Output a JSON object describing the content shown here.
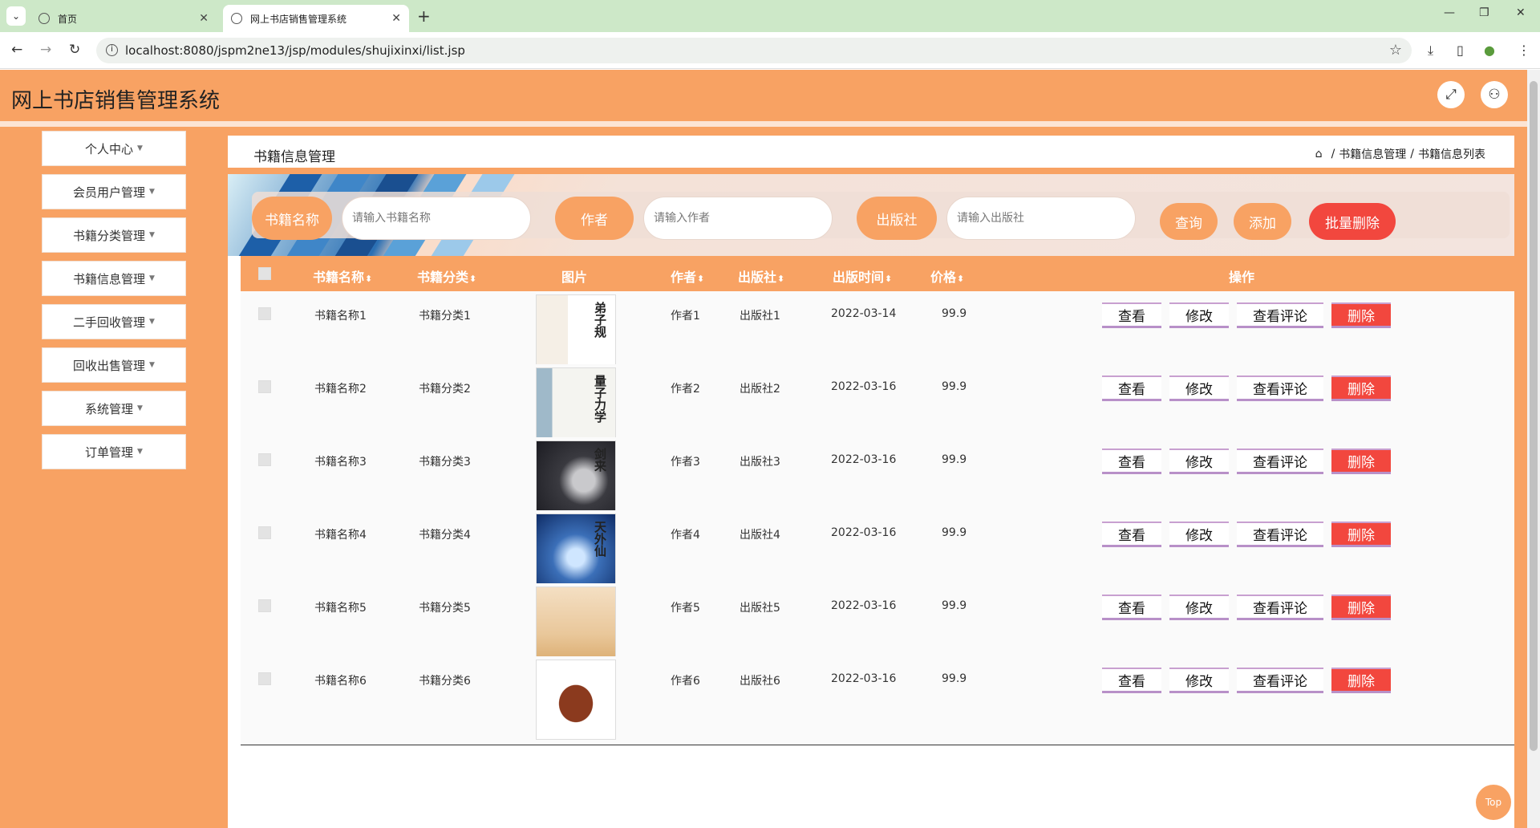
{
  "browser": {
    "tabs": [
      {
        "label": "首页",
        "active": false
      },
      {
        "label": "网上书店销售管理系统",
        "active": true
      }
    ],
    "url": "localhost:8080/jspm2ne13/jsp/modules/shujixinxi/list.jsp"
  },
  "header": {
    "title": "网上书店销售管理系统"
  },
  "sidebar": {
    "items": [
      {
        "label": "个人中心"
      },
      {
        "label": "会员用户管理"
      },
      {
        "label": "书籍分类管理"
      },
      {
        "label": "书籍信息管理"
      },
      {
        "label": "二手回收管理"
      },
      {
        "label": "回收出售管理"
      },
      {
        "label": "系统管理"
      },
      {
        "label": "订单管理"
      }
    ]
  },
  "page": {
    "title": "书籍信息管理",
    "breadcrumb": [
      "书籍信息管理",
      "书籍信息列表"
    ]
  },
  "search": {
    "name_label": "书籍名称",
    "name_placeholder": "请输入书籍名称",
    "author_label": "作者",
    "author_placeholder": "请输入作者",
    "publisher_label": "出版社",
    "publisher_placeholder": "请输入出版社",
    "query_label": "查询",
    "add_label": "添加",
    "batch_delete_label": "批量删除"
  },
  "table": {
    "columns": [
      "书籍名称",
      "书籍分类",
      "图片",
      "作者",
      "出版社",
      "出版时间",
      "价格",
      "操作"
    ],
    "rows": [
      {
        "name": "书籍名称1",
        "category": "书籍分类1",
        "author": "作者1",
        "publisher": "出版社1",
        "date": "2022-03-14",
        "price": "99.9",
        "cover": "cover-1"
      },
      {
        "name": "书籍名称2",
        "category": "书籍分类2",
        "author": "作者2",
        "publisher": "出版社2",
        "date": "2022-03-16",
        "price": "99.9",
        "cover": "cover-2"
      },
      {
        "name": "书籍名称3",
        "category": "书籍分类3",
        "author": "作者3",
        "publisher": "出版社3",
        "date": "2022-03-16",
        "price": "99.9",
        "cover": "cover-3"
      },
      {
        "name": "书籍名称4",
        "category": "书籍分类4",
        "author": "作者4",
        "publisher": "出版社4",
        "date": "2022-03-16",
        "price": "99.9",
        "cover": "cover-4"
      },
      {
        "name": "书籍名称5",
        "category": "书籍分类5",
        "author": "作者5",
        "publisher": "出版社5",
        "date": "2022-03-16",
        "price": "99.9",
        "cover": "cover-5"
      },
      {
        "name": "书籍名称6",
        "category": "书籍分类6",
        "author": "作者6",
        "publisher": "出版社6",
        "date": "2022-03-16",
        "price": "99.9",
        "cover": "cover-6"
      }
    ],
    "actions": {
      "view": "查看",
      "edit": "修改",
      "comments": "查看评论",
      "delete": "删除"
    }
  },
  "to_top": "Top",
  "colors": {
    "accent": "#f8a263",
    "delete": "#f2473e"
  }
}
